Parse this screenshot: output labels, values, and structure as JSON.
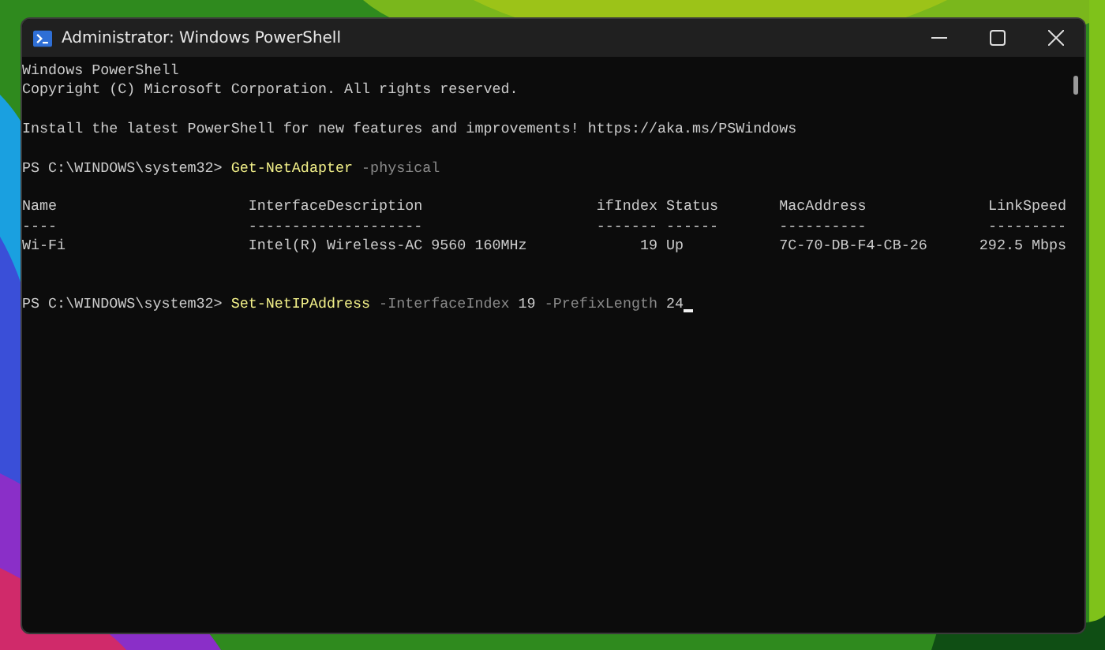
{
  "window": {
    "title": "Administrator: Windows PowerShell"
  },
  "lines_before": [
    {
      "kind": "text",
      "segments": [
        {
          "kind": "plain",
          "text": "Windows PowerShell"
        }
      ]
    },
    {
      "kind": "text",
      "segments": [
        {
          "kind": "plain",
          "text": "Copyright (C) Microsoft Corporation. All rights reserved."
        }
      ]
    },
    {
      "kind": "blank"
    },
    {
      "kind": "text",
      "segments": [
        {
          "kind": "plain",
          "text": "Install the latest PowerShell for new features and improvements! https://aka.ms/PSWindows"
        }
      ]
    },
    {
      "kind": "blank"
    },
    {
      "kind": "text",
      "segments": [
        {
          "kind": "plain",
          "text": "PS C:\\WINDOWS\\system32> "
        },
        {
          "kind": "command",
          "text": "Get-NetAdapter"
        },
        {
          "kind": "param",
          "text": " -physical"
        }
      ]
    },
    {
      "kind": "blank"
    }
  ],
  "table": {
    "columns": [
      {
        "header": "Name",
        "rule": "----"
      },
      {
        "header": "InterfaceDescription",
        "rule": "--------------------"
      },
      {
        "header": "ifIndex",
        "rule": "-------"
      },
      {
        "header": "Status",
        "rule": "------"
      },
      {
        "header": "MacAddress",
        "rule": "----------"
      },
      {
        "header": "LinkSpeed",
        "rule": "---------"
      }
    ],
    "rows": [
      [
        "Wi-Fi",
        "Intel(R) Wireless-AC 9560 160MHz",
        "19",
        "Up",
        "7C-70-DB-F4-CB-26",
        "292.5 Mbps"
      ]
    ]
  },
  "lines_after": [
    {
      "kind": "blank"
    },
    {
      "kind": "blank"
    },
    {
      "kind": "text",
      "segments": [
        {
          "kind": "plain",
          "text": "PS C:\\WINDOWS\\system32> "
        },
        {
          "kind": "command",
          "text": "Set-NetIPAddress"
        },
        {
          "kind": "param",
          "text": " -InterfaceIndex "
        },
        {
          "kind": "plain",
          "text": "19"
        },
        {
          "kind": "param",
          "text": " -PrefixLength "
        },
        {
          "kind": "plain",
          "text": "24"
        }
      ],
      "cursor": true
    }
  ]
}
